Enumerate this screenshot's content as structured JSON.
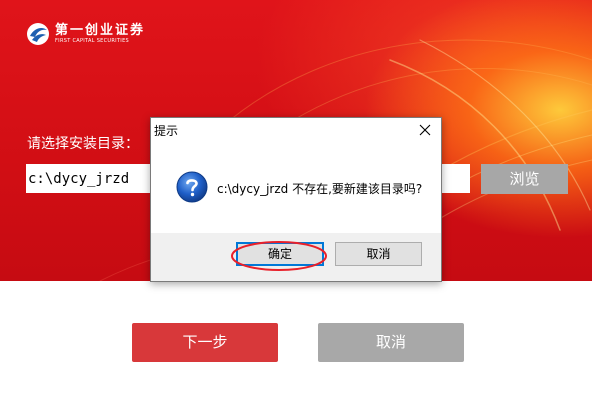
{
  "brand": {
    "name_cn": "第一创业证券",
    "name_en": "FIRST CAPITAL SECURITIES"
  },
  "installer": {
    "dir_label": "请选择安装目录：",
    "install_path": "c:\\dycy_jrzd",
    "browse_label": "浏览",
    "next_label": "下一步",
    "cancel_label": "取消"
  },
  "dialog": {
    "title": "提示",
    "message": "c:\\dycy_jrzd  不存在,要新建该目录吗?",
    "ok_label": "确定",
    "cancel_label": "取消",
    "icon": "question-icon"
  },
  "colors": {
    "hero_red": "#d10e14",
    "next_button": "#d8383a",
    "disabled_button": "#a8a8a8",
    "annotation_ring": "#e8202a"
  }
}
